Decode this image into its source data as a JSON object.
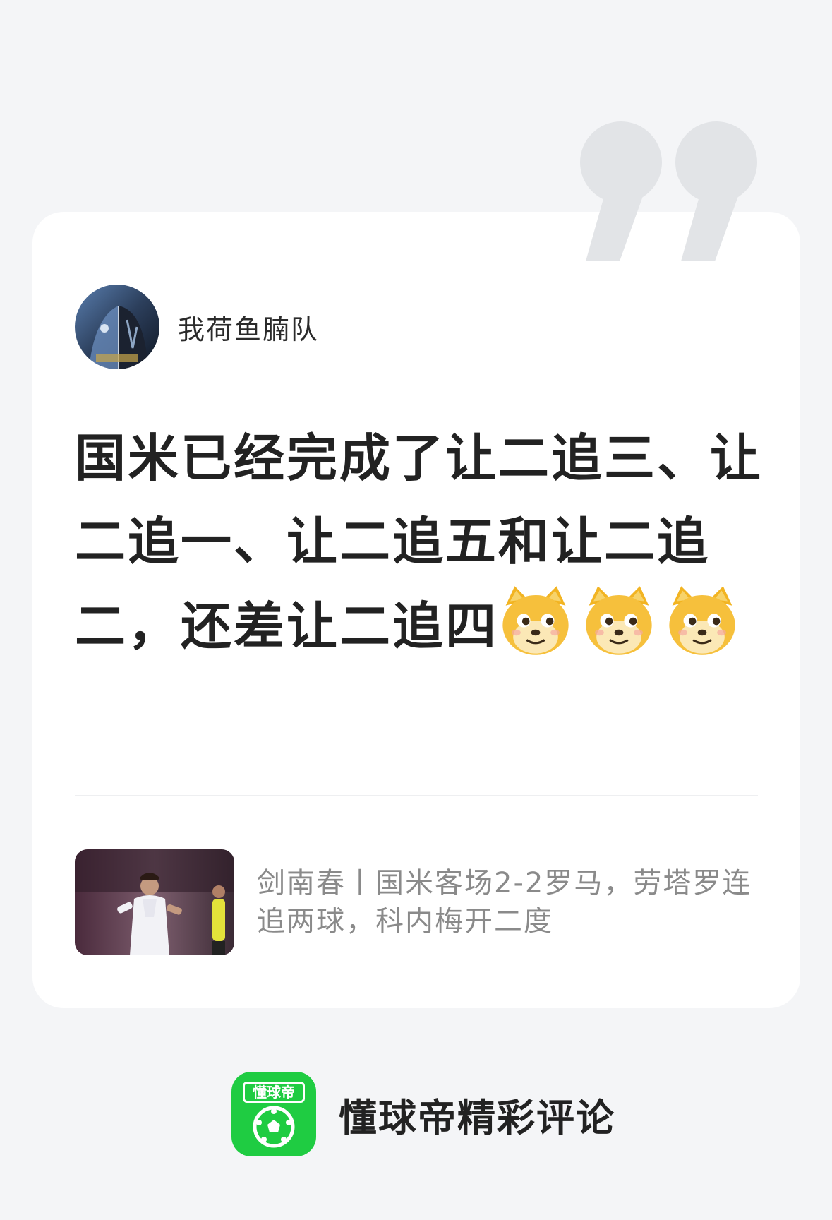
{
  "card": {
    "author": {
      "name": "我荷鱼腩队"
    },
    "comment": {
      "text": "国米已经完成了让二追三、让二追一、让二追五和让二追二，还差让二追四",
      "emoji_count": 3,
      "emoji_icon": "doge-emoji"
    },
    "article": {
      "title": "剑南春丨国米客场2-2罗马，劳塔罗连追两球，科内梅开二度"
    }
  },
  "footer": {
    "app_icon_label": "懂球帝",
    "text": "懂球帝精彩评论"
  },
  "colors": {
    "background": "#f4f5f7",
    "card": "#ffffff",
    "brand_green": "#1fcc42",
    "quote_mark": "#e2e4e7",
    "secondary_text": "#8a8a8a"
  }
}
